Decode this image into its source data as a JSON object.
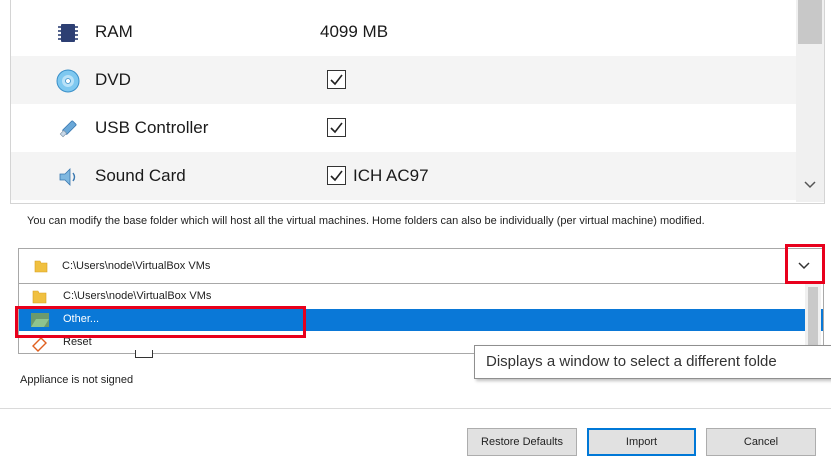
{
  "settings": {
    "rows": [
      {
        "label": "RAM",
        "value": "4099 MB"
      },
      {
        "label": "DVD",
        "checked": true
      },
      {
        "label": "USB Controller",
        "checked": true
      },
      {
        "label": "Sound Card",
        "checked": true,
        "extra": "ICH AC97"
      }
    ]
  },
  "info_text": "You can modify the base folder which will host all the virtual machines. Home folders can also be individually (per virtual machine) modified.",
  "folder_combo": {
    "value": "C:\\Users\\node\\VirtualBox VMs",
    "options": [
      {
        "label": "C:\\Users\\node\\VirtualBox VMs"
      },
      {
        "label": "Other...",
        "selected": true
      },
      {
        "label": "Reset"
      }
    ]
  },
  "tooltip": "Displays a window to select a different folde",
  "signature_status": "Appliance is not signed",
  "buttons": {
    "restore_defaults": "Restore Defaults",
    "import": "Import",
    "cancel": "Cancel"
  },
  "colors": {
    "selection": "#0a78d7",
    "highlight_box": "#e8001c",
    "primary_border": "#0078d7"
  }
}
